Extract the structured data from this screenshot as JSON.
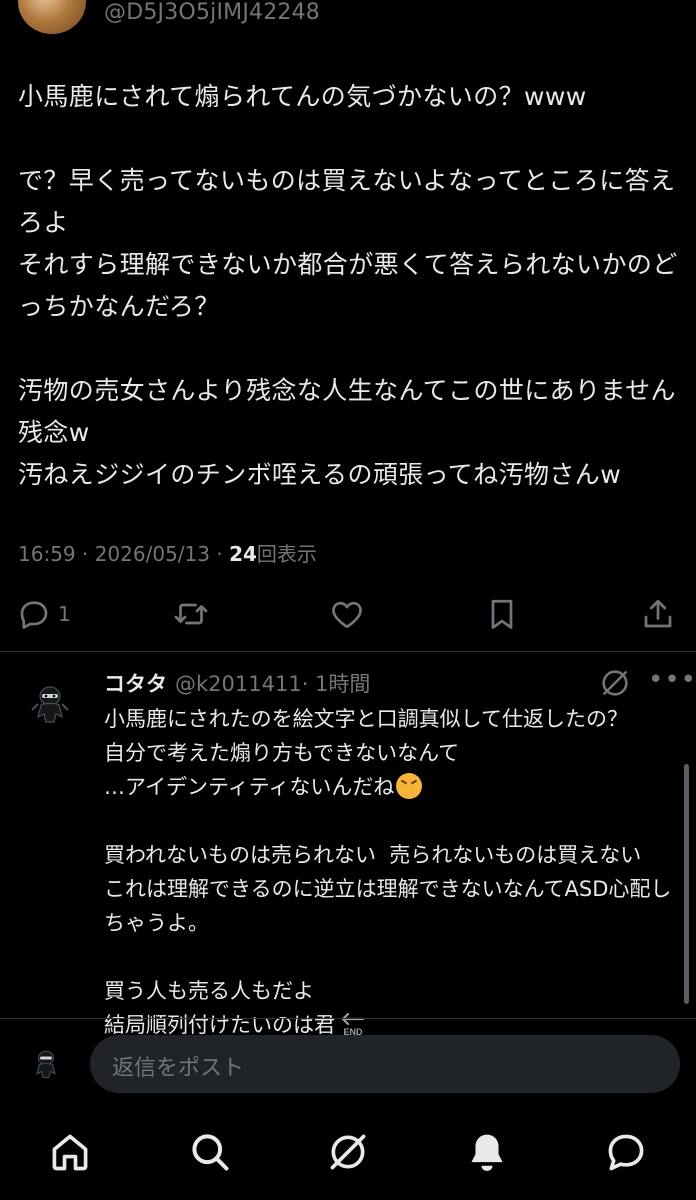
{
  "post": {
    "handle": "@D5J3O5jIMJ42248",
    "text": "小馬鹿にされて煽られてんの気づかないの？www\n\nで？早く売ってないものは買えないよなってところに答えろよ\nそれすら理解できないか都合が悪くて答えられないかのどっちかなんだろ？\n\n汚物の売女さんより残念な人生なんてこの世にありません残念w\n汚ねえジジイのチンボ咥えるの頑張ってね汚物さんw",
    "time": "16:59 · 2026/05/13 · ",
    "views_count": "24",
    "views_label": "回表示",
    "reply_count": "1"
  },
  "reply": {
    "name": "コタタ",
    "handle": "@k2011411",
    "age": "· 1時間",
    "text_1": "小馬鹿にされたのを絵文字と口調真似して仕返したの？\n自分で考えた煽り方もできないなんて\n…アイデンティティないんだね",
    "text_2": "\n\n買われないものは売られない  売られないものは買えない\nこれは理解できるのに逆立は理解できないなんてASD心配しちゃうよ。\n\n買う人も売る人もだよ\n結局順列付けたいのは君",
    "end_emoji_label": "END"
  },
  "composer": {
    "placeholder": "返信をポスト"
  },
  "colors": {
    "background": "#000000",
    "text": "#e7e9ea",
    "muted": "#71767b",
    "divider": "#2f3336",
    "composer_bg": "#202327"
  },
  "icons": [
    "reply-icon",
    "retweet-icon",
    "like-icon",
    "bookmark-icon",
    "share-icon",
    "grok-icon",
    "more-icon",
    "home-icon",
    "search-icon",
    "notifications-icon",
    "messages-icon"
  ]
}
